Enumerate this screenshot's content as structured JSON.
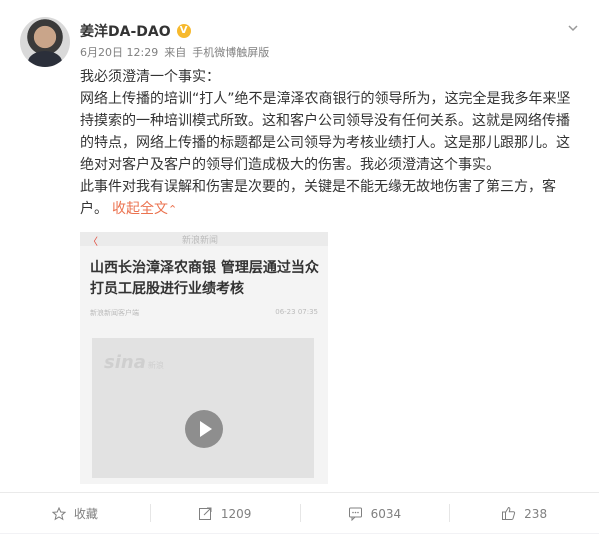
{
  "post": {
    "author": "姜洋DA-DAO",
    "verified_badge": "V",
    "date": "6月20日 12:29",
    "source_prefix": "来自",
    "source": "手机微博触屏版",
    "content": {
      "p1": "我必须澄清一个事实：",
      "p2": "网络上传播的培训“打人”绝不是漳泽农商银行的领导所为，这完全是我多年来坚持摸索的一种培训模式所致。这和客户公司领导没有任何关系。这就是网络传播的特点，网络上传播的标题都是公司领导为考核业绩打人。这是那儿跟那儿。这绝对对客户及客户的领导们造成极大的伤害。我必须澄清这个事实。",
      "p3": "此事件对我有误解和伤害是次要的，关键是不能无缘无故地伤害了第三方，客户。",
      "collapse_label": "收起全文",
      "collapse_arrow": "⌃"
    },
    "media": {
      "back": "〈",
      "site": "新浪新闻",
      "headline": "山西长治漳泽农商银 管理层通过当众打员工屁股进行业绩考核",
      "sub_left": "新浪新闻客户端",
      "sub_right": "06-23 07:35",
      "watermark": "sina",
      "watermark_sub": "新浪"
    }
  },
  "actions": {
    "favorite": "收藏",
    "repost": "1209",
    "comment": "6034",
    "like": "238"
  },
  "icons": {
    "more": "chevron-down-icon",
    "favorite": "star-icon",
    "repost": "repost-icon",
    "comment": "comment-icon",
    "like": "thumbs-up-icon",
    "play": "play-icon"
  },
  "colors": {
    "link": "#eb7350",
    "badge": "#f7b92d"
  }
}
